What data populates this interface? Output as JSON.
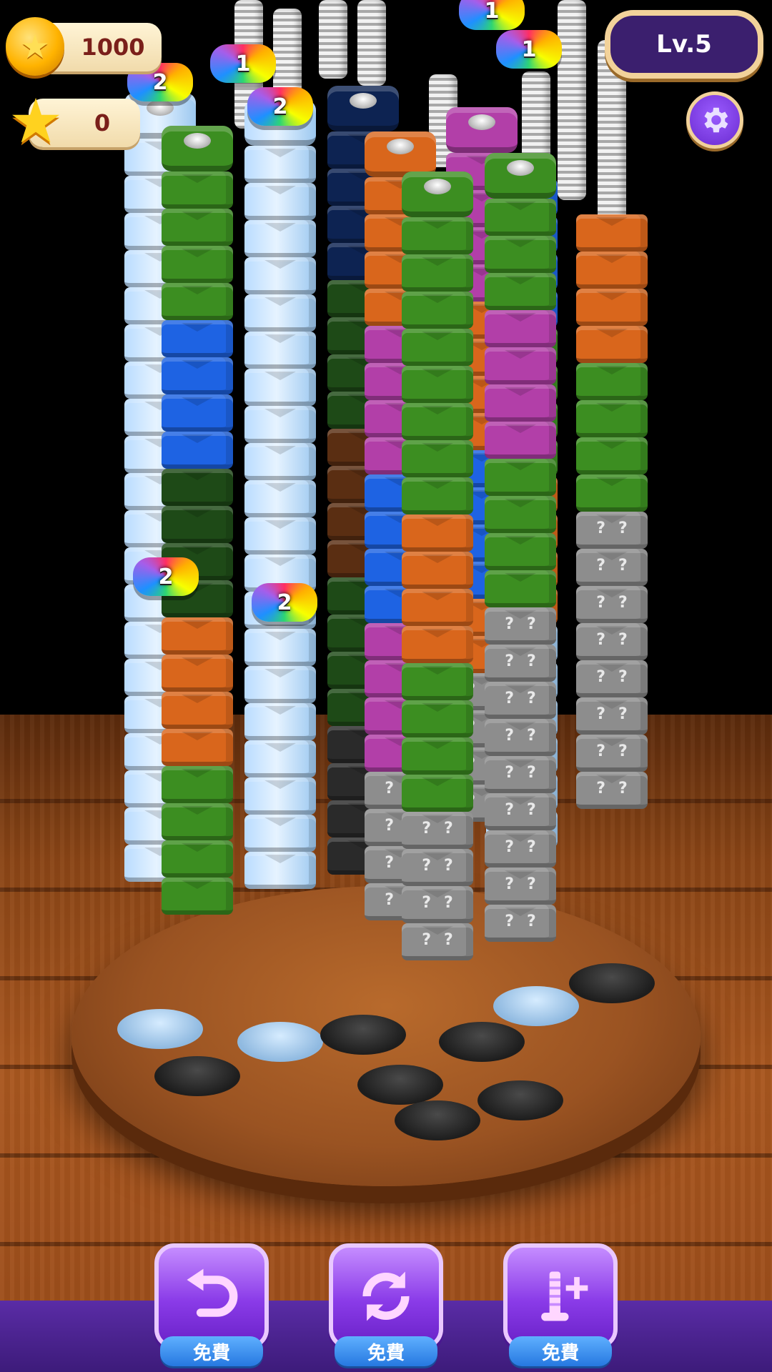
{
  "hud": {
    "coins": "1000",
    "stars": "0",
    "level": "Lv.5",
    "settings_icon": "gear-icon"
  },
  "badges": {
    "badge_a": "2",
    "badge_b": "1",
    "badge_c": "2",
    "badge_d": "1",
    "badge_e": "1",
    "badge_f": "2",
    "badge_g": "2"
  },
  "tools": {
    "undo_label": "免費",
    "shuffle_label": "免費",
    "add_rod_label": "免費",
    "undo_icon": "undo-icon",
    "shuffle_icon": "shuffle-icon",
    "add_rod_icon": "add-rod-icon"
  },
  "colors": {
    "green": "#3c8e21",
    "dark_green": "#1e4a17",
    "blue": "#1e63e3",
    "orange": "#d9661c",
    "purple": "#b23fa8",
    "navy": "#0d2352",
    "gray_mystery": "#8d8d8d",
    "ice": "#cfe6ff"
  },
  "mystery_mark": "?"
}
